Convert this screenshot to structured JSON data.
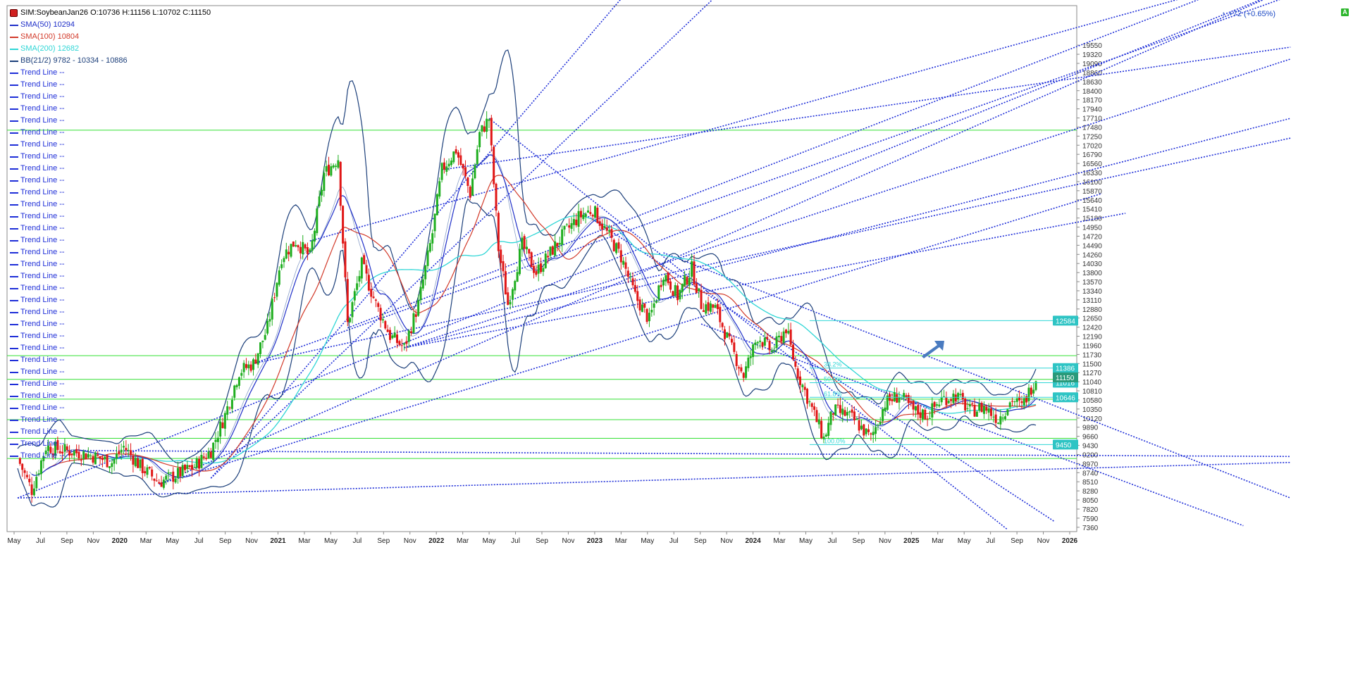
{
  "header": {
    "symbol_line": "SIM:SoybeanJan26 O:10736 H:11156 L:10702 C:11150",
    "performance": "+72 (+0.65%)"
  },
  "legend": [
    {
      "label": "SMA(50)  10294",
      "color": "#1f2fc8"
    },
    {
      "label": "SMA(100)  10804",
      "color": "#d23a2a"
    },
    {
      "label": "SMA(200)  12682",
      "color": "#2fd6d6"
    },
    {
      "label": "BB(21/2)  9782 - 10334 - 10886",
      "color": "#1c3f7a"
    }
  ],
  "trend_line_label": "Trend Line  --",
  "trend_line_count": 33,
  "colors": {
    "up_candle": "#1fae1f",
    "down_candle": "#e01616",
    "sma50": "#1f2fc8",
    "sma100": "#d23a2a",
    "sma200": "#2fd6d6",
    "bollinger": "#1c3f7a",
    "trend": "#1e2ed8",
    "horizontal": "#33e033",
    "fib": "#2fd6d6"
  },
  "chart_data": {
    "type": "candlestick",
    "y_axis": {
      "min": 7250,
      "max": 20550,
      "ticks": [
        7360,
        7590,
        7820,
        8050,
        8280,
        8510,
        8740,
        8970,
        9200,
        9430,
        9660,
        9890,
        10120,
        10350,
        10580,
        10810,
        11040,
        11270,
        11500,
        11730,
        11960,
        12190,
        12420,
        12650,
        12880,
        13110,
        13340,
        13570,
        13800,
        14030,
        14260,
        14490,
        14720,
        14950,
        15180,
        15410,
        15640,
        15870,
        16100,
        16330,
        16560,
        16790,
        17020,
        17250,
        17480,
        17710,
        17940,
        18170,
        18400,
        18630,
        18860,
        19090,
        19320,
        19550
      ]
    },
    "x_axis_labels": [
      "May",
      "Jul",
      "Sep",
      "Nov",
      "2020",
      "Mar",
      "May",
      "Jul",
      "Sep",
      "Nov",
      "2021",
      "Mar",
      "May",
      "Jul",
      "Sep",
      "Nov",
      "2022",
      "Mar",
      "May",
      "Jul",
      "Sep",
      "Nov",
      "2023",
      "Mar",
      "May",
      "Jul",
      "Sep",
      "Nov",
      "2024",
      "Mar",
      "May",
      "Jul",
      "Sep",
      "Nov",
      "2025",
      "Mar",
      "May",
      "Jul",
      "Sep",
      "Nov",
      "2026"
    ],
    "price_path_approx": [
      [
        0,
        9100
      ],
      [
        6,
        8300
      ],
      [
        12,
        9400
      ],
      [
        20,
        9300
      ],
      [
        30,
        9200
      ],
      [
        40,
        9000
      ],
      [
        45,
        9400
      ],
      [
        52,
        8900
      ],
      [
        60,
        8500
      ],
      [
        68,
        8700
      ],
      [
        75,
        8900
      ],
      [
        82,
        9300
      ],
      [
        88,
        10200
      ],
      [
        94,
        11300
      ],
      [
        100,
        11500
      ],
      [
        106,
        12400
      ],
      [
        112,
        14200
      ],
      [
        118,
        14600
      ],
      [
        124,
        14200
      ],
      [
        130,
        16300
      ],
      [
        136,
        16700
      ],
      [
        140,
        12500
      ],
      [
        146,
        14000
      ],
      [
        152,
        13000
      ],
      [
        158,
        12200
      ],
      [
        164,
        11900
      ],
      [
        170,
        13000
      ],
      [
        176,
        14800
      ],
      [
        180,
        16400
      ],
      [
        186,
        16900
      ],
      [
        192,
        15800
      ],
      [
        196,
        17300
      ],
      [
        200,
        17700
      ],
      [
        204,
        14400
      ],
      [
        208,
        13000
      ],
      [
        214,
        14500
      ],
      [
        220,
        13800
      ],
      [
        226,
        14300
      ],
      [
        232,
        14800
      ],
      [
        238,
        15200
      ],
      [
        244,
        15400
      ],
      [
        250,
        14800
      ],
      [
        256,
        14200
      ],
      [
        262,
        13200
      ],
      [
        268,
        12600
      ],
      [
        274,
        13800
      ],
      [
        280,
        13200
      ],
      [
        286,
        13900
      ],
      [
        290,
        13000
      ],
      [
        296,
        12900
      ],
      [
        302,
        12000
      ],
      [
        308,
        11200
      ],
      [
        314,
        12200
      ],
      [
        320,
        11800
      ],
      [
        326,
        12400
      ],
      [
        330,
        11400
      ],
      [
        336,
        10500
      ],
      [
        342,
        9600
      ],
      [
        346,
        10300
      ],
      [
        352,
        10200
      ],
      [
        356,
        10000
      ],
      [
        362,
        9600
      ],
      [
        368,
        10500
      ],
      [
        374,
        10700
      ],
      [
        380,
        10300
      ],
      [
        386,
        10200
      ],
      [
        392,
        10600
      ],
      [
        398,
        10700
      ],
      [
        404,
        10300
      ],
      [
        410,
        10400
      ],
      [
        416,
        10100
      ],
      [
        422,
        10600
      ],
      [
        426,
        10400
      ],
      [
        432,
        11150
      ]
    ],
    "overlays": [
      "SMA(50)",
      "SMA(100)",
      "SMA(200)",
      "BB(21/2)"
    ],
    "price_labels": [
      {
        "value": 12584,
        "text": "12584"
      },
      {
        "value": 11386,
        "text": "11386"
      },
      {
        "value": 11016,
        "text": "11016"
      },
      {
        "value": 10646,
        "text": "10646"
      },
      {
        "value": 9450,
        "text": "9450"
      },
      {
        "value": 11150,
        "text": "11150",
        "current": true
      }
    ],
    "horizontal_levels": [
      17400,
      11700,
      11100,
      10600,
      10080,
      9610,
      9100
    ],
    "fib_labels": [
      "38.2%",
      "50.0%",
      "61.8%",
      "100.0%"
    ]
  }
}
